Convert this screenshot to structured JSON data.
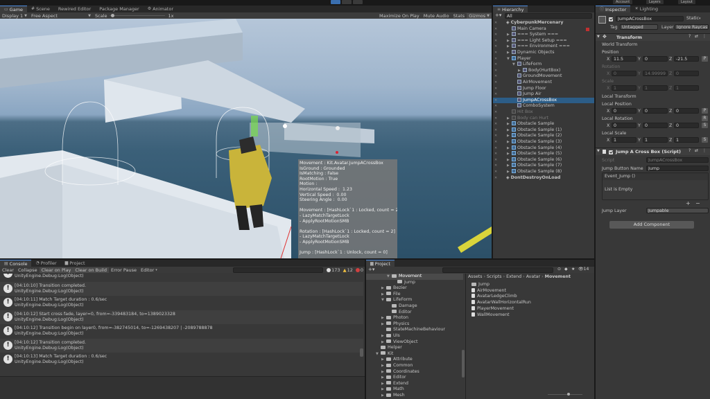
{
  "topbar": {
    "items": [
      "Account",
      "Layers",
      "Layout"
    ]
  },
  "game_panel": {
    "tabs": [
      "Game",
      "Scene",
      "Rewired Editor",
      "Package Manager",
      "Animator"
    ],
    "toolbar": {
      "display": "Display 1",
      "aspect": "Free Aspect",
      "scale_label": "Scale",
      "scale_value": "1x",
      "maximize": "Maximize On Play",
      "mute": "Mute Audio",
      "stats": "Stats",
      "gizmos": "Gizmos"
    },
    "debug_overlay": [
      "Movement : Kit.Avatar.JumpACrossBox",
      "IsGround : Grounded",
      "IsMatching : False",
      "RootMotion : True",
      "Motion :",
      "Horizontal Speed :  1.23",
      "Vertical Speed :  0.00",
      "Steering Angle :  0.00",
      "",
      "Movement : [HashLock`1 : Locked, count = 2]",
      "- LazyMatchTargetLock",
      "- ApplyRootMotionSMB",
      "",
      "Rotation : [HashLock`1 : Locked, count = 2]",
      "- LazyMatchTargetLock",
      "- ApplyRootMotionSMB",
      "",
      "Jump : [HashLock`1 : Unlock, count = 0]"
    ]
  },
  "hierarchy": {
    "tab": "Hierarchy",
    "search": "All",
    "items": [
      {
        "label": "CyberpunkMercenary",
        "depth": 0,
        "type": "scene"
      },
      {
        "label": "Main Camera",
        "depth": 1,
        "type": "obj"
      },
      {
        "label": "=== System ===",
        "depth": 1,
        "type": "obj",
        "arrow": true
      },
      {
        "label": "=== Light Setup ===",
        "depth": 1,
        "type": "obj",
        "arrow": true
      },
      {
        "label": "=== Environment ===",
        "depth": 1,
        "type": "obj",
        "arrow": true
      },
      {
        "label": "Dynamic Objects",
        "depth": 1,
        "type": "obj",
        "arrow": true
      },
      {
        "label": "Player",
        "depth": 1,
        "type": "blue",
        "open": true
      },
      {
        "label": "LifeForm",
        "depth": 2,
        "type": "obj",
        "open": true
      },
      {
        "label": "Body(HurtBox)",
        "depth": 3,
        "type": "obj",
        "arrow": true
      },
      {
        "label": "GroundMovement",
        "depth": 2,
        "type": "obj"
      },
      {
        "label": "AirMovement",
        "depth": 2,
        "type": "obj"
      },
      {
        "label": "Jump Floor",
        "depth": 2,
        "type": "obj"
      },
      {
        "label": "Jump Air",
        "depth": 2,
        "type": "obj"
      },
      {
        "label": "JumpACrossBox",
        "depth": 2,
        "type": "obj",
        "selected": true
      },
      {
        "label": "ComboSystem",
        "depth": 2,
        "type": "obj"
      },
      {
        "label": "Hit Box",
        "depth": 1,
        "type": "dim",
        "dim": true
      },
      {
        "label": "Body can Hurt",
        "depth": 1,
        "type": "dim",
        "dim": true,
        "arrow": true
      },
      {
        "label": "Obstacle Sample",
        "depth": 1,
        "type": "blue",
        "arrow": true
      },
      {
        "label": "Obstacle Sample (1)",
        "depth": 1,
        "type": "blue",
        "arrow": true
      },
      {
        "label": "Obstacle Sample (2)",
        "depth": 1,
        "type": "blue",
        "arrow": true
      },
      {
        "label": "Obstacle Sample (3)",
        "depth": 1,
        "type": "blue",
        "arrow": true
      },
      {
        "label": "Obstacle Sample (4)",
        "depth": 1,
        "type": "blue",
        "arrow": true
      },
      {
        "label": "Obstacle Sample (5)",
        "depth": 1,
        "type": "blue",
        "arrow": true
      },
      {
        "label": "Obstacle Sample (6)",
        "depth": 1,
        "type": "blue",
        "arrow": true
      },
      {
        "label": "Obstacle Sample (7)",
        "depth": 1,
        "type": "blue",
        "arrow": true
      },
      {
        "label": "Obstacle Sample (8)",
        "depth": 1,
        "type": "blue",
        "arrow": true
      },
      {
        "label": "DontDestroyOnLoad",
        "depth": 0,
        "type": "scene"
      }
    ]
  },
  "inspector": {
    "tabs": [
      "Inspector",
      "Lighting"
    ],
    "object_name": "JumpACrossBox",
    "static": "Static",
    "tag_label": "Tag",
    "tag_value": "Untagged",
    "layer_label": "Layer",
    "layer_value": "Ignore Raycast",
    "transform": {
      "title": "Transform",
      "world_header": "World Transform",
      "position_label": "Position",
      "position": [
        "11.5",
        "0",
        "-21.5"
      ],
      "rotation_label": "Rotation",
      "rotation": [
        "0",
        "14.99999",
        "0"
      ],
      "scale_label": "Scale",
      "scale": [
        "1",
        "1",
        "1"
      ],
      "local_header": "Local Transform",
      "local_position_label": "Local Position",
      "local_position": [
        "0",
        "0",
        "0"
      ],
      "local_rotation_label": "Local Rotation",
      "local_rotation": [
        "0",
        "0",
        "0"
      ],
      "local_scale_label": "Local Scale",
      "local_scale": [
        "1",
        "1",
        "1"
      ],
      "axes": [
        "X",
        "Y",
        "Z"
      ],
      "side_buttons": [
        "P",
        "P",
        "R",
        "S",
        "S"
      ]
    },
    "component": {
      "title": "Jump A Cross Box (Script)",
      "script_label": "Script",
      "script_value": "JumpACrossBox",
      "jump_button_label": "Jump Button Name",
      "jump_button_value": "Jump",
      "event_label": "Event_Jump ()",
      "list_empty": "List is Empty",
      "plus": "+",
      "minus": "−",
      "jump_layer_label": "Jump Layer",
      "jump_layer_value": "Jumpable"
    },
    "add_component": "Add Component"
  },
  "console": {
    "tabs": [
      "Console",
      "Profiler",
      "Project"
    ],
    "toolbar": [
      "Clear",
      "Collapse",
      "Clear on Play",
      "Clear on Build",
      "Error Pause",
      "Editor"
    ],
    "counts": {
      "info": "173",
      "warn": "12",
      "error": "0"
    },
    "entries": [
      {
        "l1": "UnityEngine.Debug:Log(Object)",
        "l2": ""
      },
      {
        "l1": "[04:10:10] Transition completed.",
        "l2": "UnityEngine.Debug:Log(Object)"
      },
      {
        "l1": "[04:10:11] Match Target duration : 0.6/sec",
        "l2": "UnityEngine.Debug:Log(Object)"
      },
      {
        "l1": "[04:10:12] Start cross fade, layer=0, from=-339483184, to=1389023328",
        "l2": "UnityEngine.Debug:Log(Object)"
      },
      {
        "l1": "[04:10:12] Transition begin on layer0, from=-382745014, to=-1269438207 | -2089788878",
        "l2": "UnityEngine.Debug:Log(Object)"
      },
      {
        "l1": "[04:10:12] Transition completed.",
        "l2": "UnityEngine.Debug:Log(Object)"
      },
      {
        "l1": "[04:10:13] Match Target duration : 0.6/sec",
        "l2": "UnityEngine.Debug:Log(Object)"
      }
    ]
  },
  "project": {
    "tab": "Project",
    "badge": "14",
    "breadcrumb": [
      "Assets",
      "Scripts",
      "Extend",
      "Avatar",
      "Movement"
    ],
    "tree": [
      {
        "label": "Movement",
        "depth": 2,
        "open": true,
        "selected": true
      },
      {
        "label": "Jump",
        "depth": 3
      },
      {
        "label": "Bezier",
        "depth": 1,
        "arrow": true
      },
      {
        "label": "File",
        "depth": 1,
        "arrow": true
      },
      {
        "label": "LifeForm",
        "depth": 1,
        "open": true
      },
      {
        "label": "Damage",
        "depth": 2
      },
      {
        "label": "Editor",
        "depth": 2
      },
      {
        "label": "Photon",
        "depth": 1,
        "arrow": true
      },
      {
        "label": "Physics",
        "depth": 1,
        "arrow": true
      },
      {
        "label": "StateMachineBehaviour",
        "depth": 1
      },
      {
        "label": "UIs",
        "depth": 1,
        "arrow": true
      },
      {
        "label": "ViewObject",
        "depth": 1,
        "arrow": true
      },
      {
        "label": "Helper",
        "depth": 0
      },
      {
        "label": "Kit",
        "depth": 0,
        "open": true
      },
      {
        "label": "Attribute",
        "depth": 1,
        "arrow": true
      },
      {
        "label": "Common",
        "depth": 1,
        "arrow": true
      },
      {
        "label": "Coordinates",
        "depth": 1,
        "arrow": true
      },
      {
        "label": "Editor",
        "depth": 1,
        "arrow": true
      },
      {
        "label": "Extend",
        "depth": 1,
        "arrow": true
      },
      {
        "label": "Math",
        "depth": 1,
        "arrow": true
      },
      {
        "label": "Mesh",
        "depth": 1,
        "arrow": true
      }
    ],
    "files": [
      {
        "label": "Jump",
        "type": "folder"
      },
      {
        "label": "AirMovement",
        "type": "script"
      },
      {
        "label": "AvatarLedgeClimb",
        "type": "script"
      },
      {
        "label": "AvatarWallHorizontalRun",
        "type": "script"
      },
      {
        "label": "PlayerMovement",
        "type": "script"
      },
      {
        "label": "WallMovement",
        "type": "script"
      }
    ]
  }
}
